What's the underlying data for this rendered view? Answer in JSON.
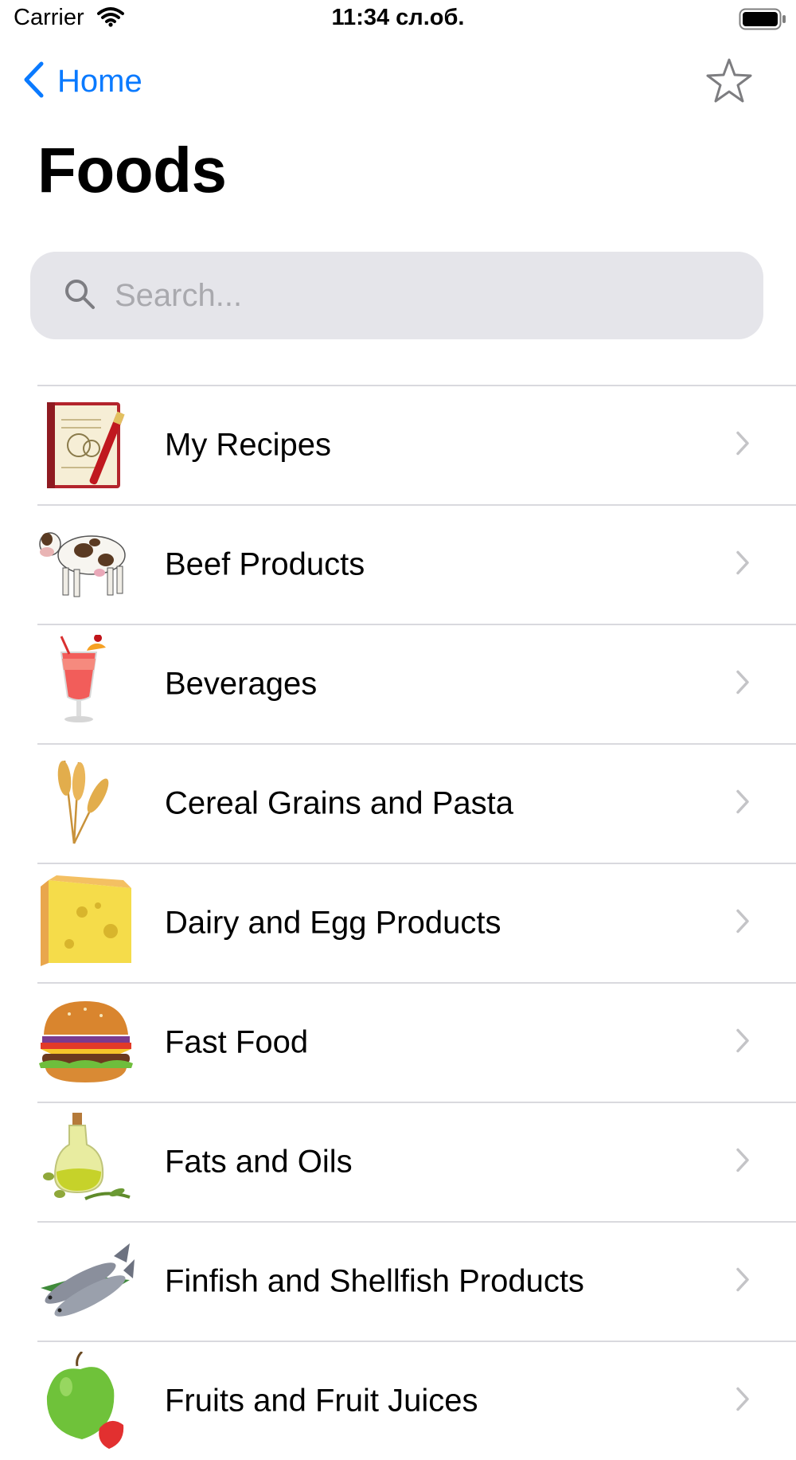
{
  "status_bar": {
    "carrier": "Carrier",
    "time": "11:34 сл.об.",
    "icons": [
      "wifi-icon",
      "battery-icon"
    ]
  },
  "nav": {
    "back_label": "Home",
    "back_icon": "chevron-left-icon",
    "favorite_icon": "star-outline-icon",
    "accent_color": "#0a7aff"
  },
  "page": {
    "title": "Foods"
  },
  "search": {
    "placeholder": "Search...",
    "value": "",
    "icon": "search-icon",
    "background": "#e5e5ea"
  },
  "categories": [
    {
      "label": "My Recipes",
      "icon": "recipe-book-icon"
    },
    {
      "label": "Beef Products",
      "icon": "cow-icon"
    },
    {
      "label": "Beverages",
      "icon": "cocktail-icon"
    },
    {
      "label": "Cereal Grains and Pasta",
      "icon": "wheat-icon"
    },
    {
      "label": "Dairy and Egg Products",
      "icon": "cheese-icon"
    },
    {
      "label": "Fast Food",
      "icon": "burger-icon"
    },
    {
      "label": "Fats and Oils",
      "icon": "olive-oil-icon"
    },
    {
      "label": "Finfish and Shellfish Products",
      "icon": "fish-icon"
    },
    {
      "label": "Fruits and Fruit Juices",
      "icon": "apple-icon"
    }
  ]
}
